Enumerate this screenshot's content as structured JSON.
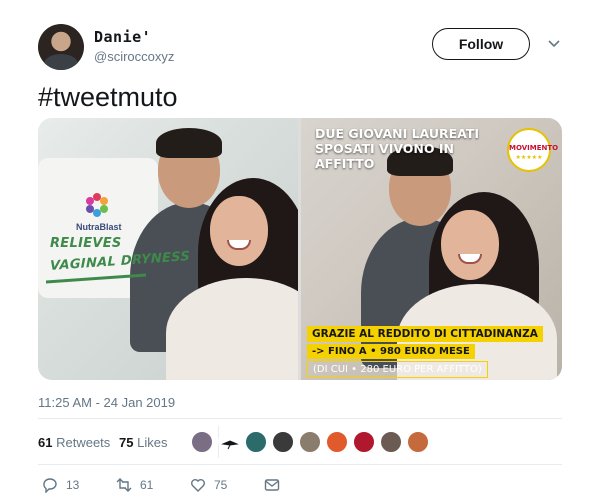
{
  "user": {
    "display_name": "Danie'",
    "handle": "@sciroccoxyz",
    "avatar_icon": "user-avatar-photo"
  },
  "follow_button": {
    "label": "Follow"
  },
  "menu_icon": "chevron-down-icon",
  "tweet": {
    "text": "#tweetmuto"
  },
  "media": {
    "left_image": {
      "brand": "NutraBlast",
      "headline_line1": "RELIEVES",
      "headline_line2": "VAGINAL DRYNESS"
    },
    "right_image": {
      "headline_line1": "DUE GIOVANI LAUREATI",
      "headline_line2": "SPOSATI VIVONO IN AFFITTO",
      "logo_text": "MOVIMENTO",
      "banner_line1": "GRAZIE AL REDDITO DI CITTADINANZA",
      "banner_line2": "-> FINO A • 980 EURO MESE",
      "banner_line3": "(DI CUI • 280 EURO PER AFFITTO)"
    }
  },
  "timestamp": "11:25 AM - 24 Jan 2019",
  "stats": {
    "retweets_count": "61",
    "retweets_label": "Retweets",
    "likes_count": "75",
    "likes_label": "Likes"
  },
  "likers": [
    {
      "color": "#7a6e84"
    },
    {
      "color": "#ffffff"
    },
    {
      "color": "#2b6b6a"
    },
    {
      "color": "#3a3a3a"
    },
    {
      "color": "#8a7d6e"
    },
    {
      "color": "#e05a2b"
    },
    {
      "color": "#b0182e"
    },
    {
      "color": "#6b5b52"
    },
    {
      "color": "#c56a3c"
    }
  ],
  "actions": {
    "reply_count": "13",
    "retweet_count": "61",
    "like_count": "75",
    "reply_icon": "reply-icon",
    "retweet_icon": "retweet-icon",
    "like_icon": "heart-icon",
    "dm_icon": "envelope-icon"
  }
}
